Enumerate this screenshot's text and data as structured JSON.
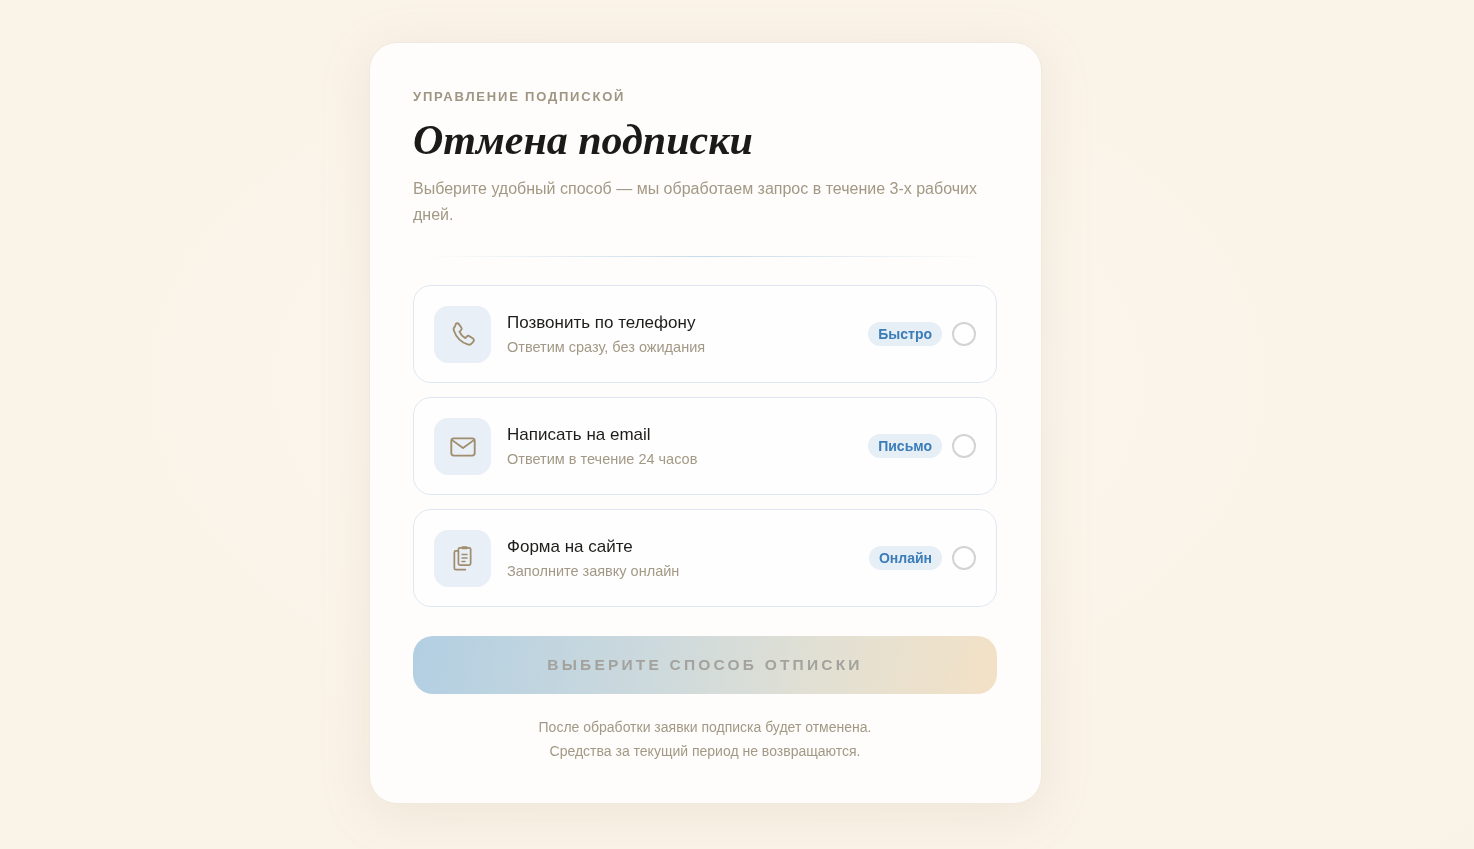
{
  "header": {
    "eyebrow": "УПРАВЛЕНИЕ ПОДПИСКОЙ",
    "title": "Отмена подписки",
    "subtitle": "Выберите удобный способ — мы обработаем запрос в течение 3-х рабочих дней."
  },
  "options": [
    {
      "kind": "phone",
      "title": "Позвонить по телефону",
      "description": "Ответим сразу, без ожидания",
      "badge": "Быстро",
      "selected": false
    },
    {
      "kind": "email",
      "title": "Написать на email",
      "description": "Ответим в течение 24 часов",
      "badge": "Письмо",
      "selected": false
    },
    {
      "kind": "form",
      "title": "Форма на сайте",
      "description": "Заполните заявку онлайн",
      "badge": "Онлайн",
      "selected": false
    }
  ],
  "submit": {
    "label": "ВЫБЕРИТЕ СПОСОБ ОТПИСКИ",
    "disabled": true
  },
  "footnote": [
    "После обработки заявки подписка будет отменена.",
    "Средства за текущий период не возвращаются."
  ]
}
